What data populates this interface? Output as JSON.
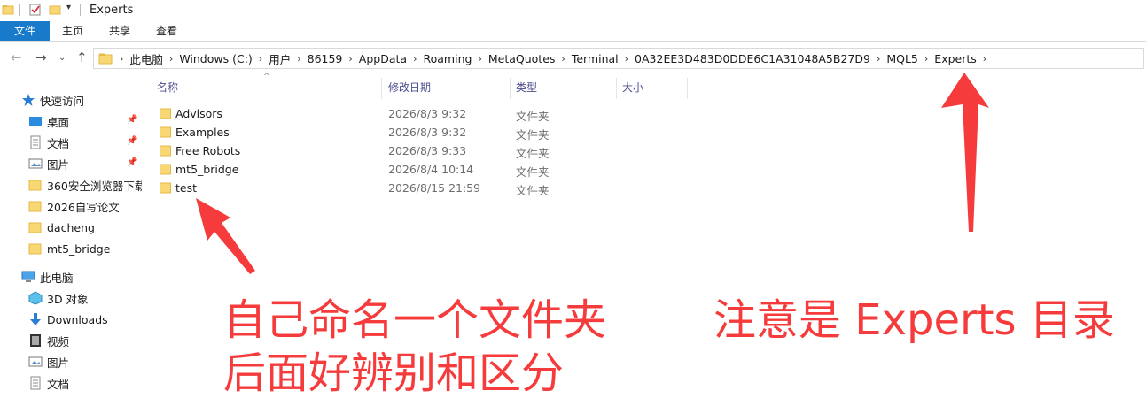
{
  "window": {
    "title": "Experts"
  },
  "ribbon": {
    "file_tab": "文件",
    "tabs": [
      "主页",
      "共享",
      "查看"
    ]
  },
  "address_bar": {
    "crumbs": [
      "此电脑",
      "Windows (C:)",
      "用户",
      "86159",
      "AppData",
      "Roaming",
      "MetaQuotes",
      "Terminal",
      "0A32EE3D483D0DDE6C1A31048A5B27D9",
      "MQL5",
      "Experts"
    ]
  },
  "nav_pane": {
    "quick_access": "快速访问",
    "items": [
      {
        "label": "桌面",
        "icon": "desktop-icon",
        "pinned": true
      },
      {
        "label": "文档",
        "icon": "document-icon",
        "pinned": true
      },
      {
        "label": "图片",
        "icon": "picture-icon",
        "pinned": true
      },
      {
        "label": "360安全浏览器下载",
        "icon": "folder-icon",
        "pinned": false
      },
      {
        "label": "2026自写论文",
        "icon": "folder-icon",
        "pinned": false
      },
      {
        "label": "dacheng",
        "icon": "folder-icon",
        "pinned": false
      },
      {
        "label": "mt5_bridge",
        "icon": "folder-icon",
        "pinned": false
      }
    ],
    "this_pc": "此电脑",
    "pc_items": [
      {
        "label": "3D 对象",
        "icon": "3d-objects-icon"
      },
      {
        "label": "Downloads",
        "icon": "download-icon"
      },
      {
        "label": "视频",
        "icon": "video-icon"
      },
      {
        "label": "图片",
        "icon": "picture-icon"
      },
      {
        "label": "文档",
        "icon": "document-icon"
      }
    ]
  },
  "columns": {
    "name": "名称",
    "modified": "修改日期",
    "type": "类型",
    "size": "大小"
  },
  "files": [
    {
      "name": "Advisors",
      "modified": "2026/8/3 9:32",
      "type": "文件夹"
    },
    {
      "name": "Examples",
      "modified": "2026/8/3 9:32",
      "type": "文件夹"
    },
    {
      "name": "Free Robots",
      "modified": "2026/8/3 9:33",
      "type": "文件夹"
    },
    {
      "name": "mt5_bridge",
      "modified": "2026/8/4 10:14",
      "type": "文件夹"
    },
    {
      "name": "test",
      "modified": "2026/8/15 21:59",
      "type": "文件夹"
    }
  ],
  "annotations": {
    "left_line1": "自己命名一个文件夹",
    "left_line2": "后面好辨别和区分",
    "right_line": "注意是 Experts 目录",
    "color": "#f53b3b"
  },
  "colors": {
    "file_tab": "#1979ca",
    "folder": "#f8d775",
    "folder_dark": "#e6b84a"
  }
}
